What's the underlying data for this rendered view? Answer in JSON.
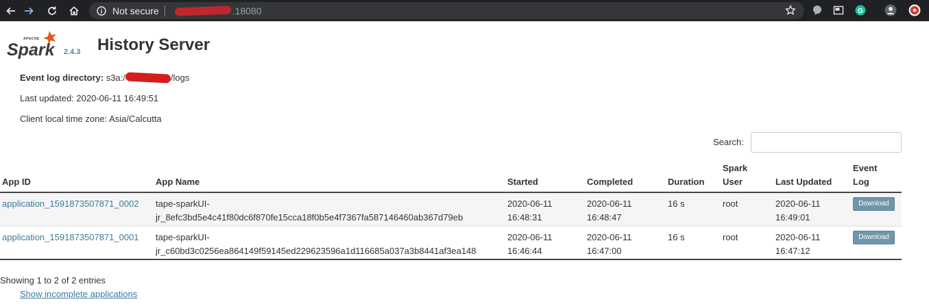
{
  "browser": {
    "security_label": "Not secure",
    "url_port": ".18080"
  },
  "header": {
    "version": "2.4.3",
    "title": "History Server"
  },
  "info": {
    "event_log_label": "Event log directory:",
    "event_log_prefix": "s3a:/",
    "event_log_suffix": "/logs",
    "last_updated": "Last updated: 2020-06-11 16:49:51",
    "timezone": "Client local time zone: Asia/Calcutta"
  },
  "search": {
    "label": "Search:",
    "value": ""
  },
  "table": {
    "columns": {
      "app_id": "App ID",
      "app_name": "App Name",
      "started": "Started",
      "completed": "Completed",
      "duration": "Duration",
      "spark_user_1": "Spark",
      "spark_user_2": "User",
      "last_updated": "Last Updated",
      "event_log_1": "Event",
      "event_log_2": "Log"
    },
    "rows": [
      {
        "app_id": "application_1591873507871_0002",
        "name_1": "tape-sparkUI-",
        "name_2": "jr_8efc3bd5e4c41f80dc6f870fe15cca18f0b5e4f7367fa587146460ab367d79eb",
        "started_1": "2020-06-11",
        "started_2": "16:48:31",
        "completed_1": "2020-06-11",
        "completed_2": "16:48:47",
        "duration": "16 s",
        "user": "root",
        "updated_1": "2020-06-11",
        "updated_2": "16:49:01",
        "download": "Download"
      },
      {
        "app_id": "application_1591873507871_0001",
        "name_1": "tape-sparkUI-",
        "name_2": "jr_c60bd3c0256ea864149f59145ed229623596a1d116685a037a3b8441af3ea148",
        "started_1": "2020-06-11",
        "started_2": "16:46:44",
        "completed_1": "2020-06-11",
        "completed_2": "16:47:00",
        "duration": "16 s",
        "user": "root",
        "updated_1": "2020-06-11",
        "updated_2": "16:47:12",
        "download": "Download"
      }
    ]
  },
  "footer": {
    "showing": "Showing 1 to 2 of 2 entries",
    "incomplete_link": "Show incomplete applications"
  },
  "colors": {
    "chrome_bg": "#202124",
    "omnibox_bg": "#35363a",
    "link": "#3d7a9b",
    "download_button": "#6f97ac",
    "spark_orange": "#e25a1c",
    "spark_text": "#3c3a3e"
  }
}
